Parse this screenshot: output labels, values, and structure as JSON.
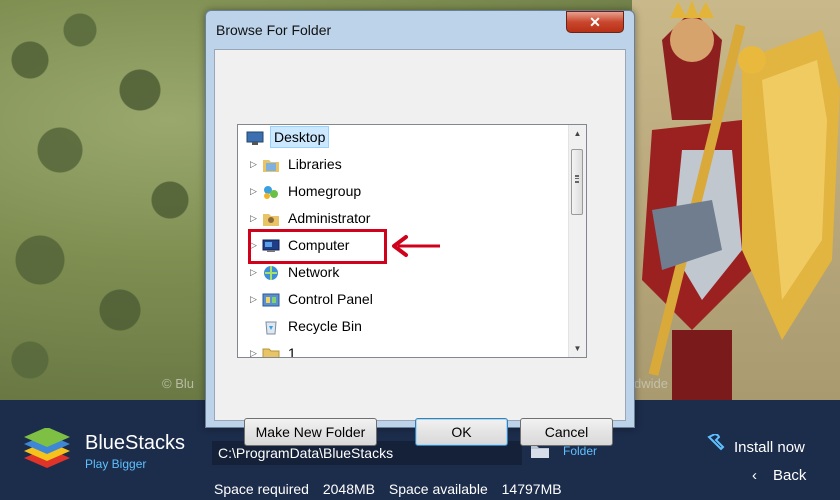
{
  "background": {
    "watermark_left": "© Blu",
    "watermark_right": "dwide"
  },
  "dialog": {
    "title": "Browse For Folder",
    "close_glyph": "✕",
    "tree_items": [
      {
        "label": "Desktop",
        "icon": "desktop-icon",
        "selected": true
      },
      {
        "label": "Libraries",
        "icon": "libraries-icon"
      },
      {
        "label": "Homegroup",
        "icon": "homegroup-icon"
      },
      {
        "label": "Administrator",
        "icon": "user-folder-icon"
      },
      {
        "label": "Computer",
        "icon": "computer-icon"
      },
      {
        "label": "Network",
        "icon": "network-icon"
      },
      {
        "label": "Control Panel",
        "icon": "control-panel-icon"
      },
      {
        "label": "Recycle Bin",
        "icon": "recycle-bin-icon"
      },
      {
        "label": "1",
        "icon": "folder-icon"
      }
    ],
    "buttons": {
      "make_new_folder": "Make New Folder",
      "ok": "OK",
      "cancel": "Cancel"
    },
    "annotation_color": "#d0021b"
  },
  "bottom_bar": {
    "brand": "BlueStacks",
    "tagline": "Play Bigger",
    "install_path": "C:\\ProgramData\\BlueStacks",
    "folder_link": "Folder",
    "space_required_label": "Space required",
    "space_required_value": "2048MB",
    "space_available_label": "Space available",
    "space_available_value": "14797MB",
    "install_now": "Install now",
    "back": "Back"
  },
  "colors": {
    "bottom_bar": "#1c2c4b",
    "accent": "#5fc0ff"
  }
}
